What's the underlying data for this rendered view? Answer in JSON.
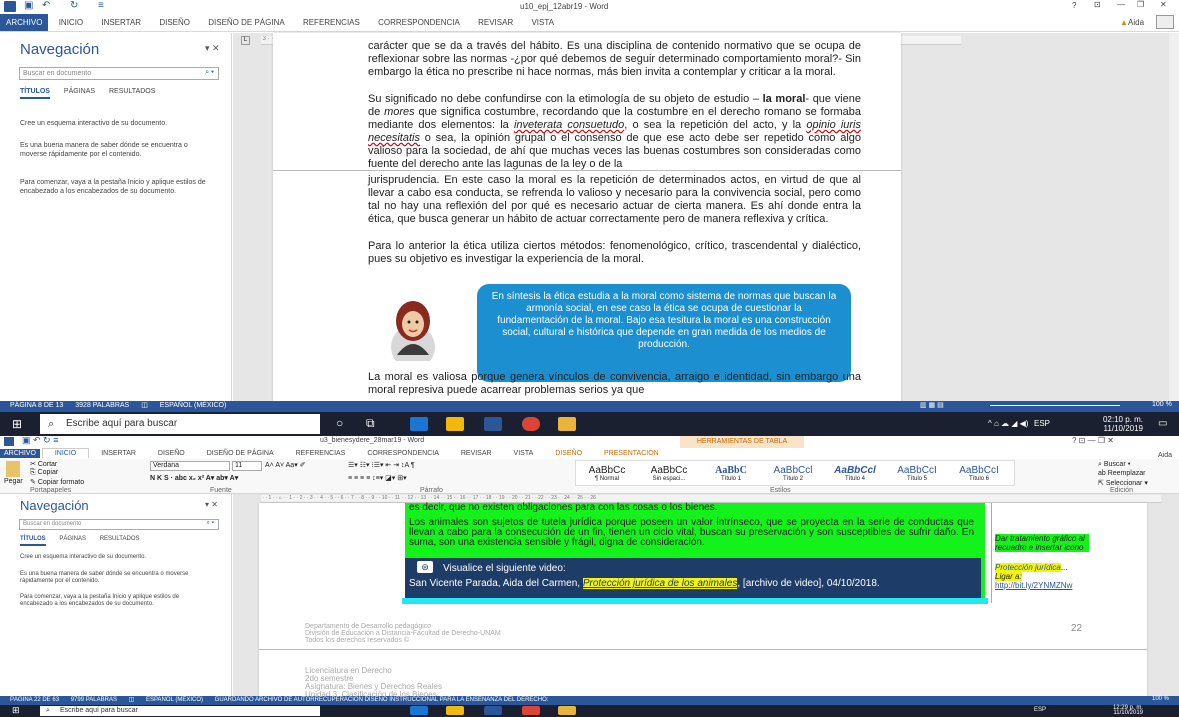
{
  "win1": {
    "title": "u10_epj_12abr19 - Word",
    "user": "Aida",
    "tabs": [
      "ARCHIVO",
      "INICIO",
      "INSERTAR",
      "DISEÑO",
      "DISEÑO DE PÁGINA",
      "REFERENCIAS",
      "CORRESPONDENCIA",
      "REVISAR",
      "VISTA"
    ],
    "nav": {
      "title": "Navegación",
      "search_placeholder": "Buscar en documento",
      "tabs": [
        "TÍTULOS",
        "PÁGINAS",
        "RESULTADOS"
      ],
      "paras": [
        "Cree un esquema interactivo de su documento.",
        "Es una buena manera de saber dónde se encuentra o moverse rápidamente por el contenido.",
        "Para comenzar, vaya a la pestaña Inicio y aplique estilos de encabezado a los encabezados de su documento."
      ]
    },
    "doc": {
      "p0": "carácter que se da a través del hábito. Es una disciplina de contenido normativo que se ocupa de reflexionar sobre las normas -¿por qué debemos de seguir determinado comportamiento moral?- Sin embargo la ética no prescribe ni hace normas, más bien invita a contemplar y criticar a la moral.",
      "p1a": "Su significado no debe confundirse con la etimología de su objeto de estudio –",
      "p1b": "la moral",
      "p1c": "- que viene de ",
      "p1d": "mores",
      "p1e": " que significa costumbre, recordando que la costumbre en el derecho romano se formaba mediante dos elementos: la ",
      "p1f": "inveterata consuetudo",
      "p1g": ", o sea la repetición del acto, y la ",
      "p1h": "opinio iuris necesitatis",
      "p1i": " o sea, la opinión grupal o el consenso de que ese acto debe ser repetido como algo valioso para la sociedad, de ahí que muchas veces las buenas costumbres son consideradas como fuente del derecho ante las lagunas de la ley o de la",
      "p2": "jurisprudencia. En este caso la moral es la repetición de determinados actos, en virtud de que al llevar a cabo esa conducta, se refrenda lo valioso y necesario para la convivencia social, pero como tal no hay una reflexión del por qué es necesario actuar de cierta manera. Es ahí donde entra la ética, que busca generar un hábito de actuar correctamente pero de manera reflexiva y crítica.",
      "p3": "Para lo anterior la ética utiliza ciertos métodos: fenomenológico, crítico, trascendental y dialéctico, pues su objetivo es investigar la experiencia de la moral.",
      "bubble": "En síntesis la ética estudia a la moral como sistema de normas que buscan la armonía social, en ese caso la ética se ocupa de cuestionar la fundamentación de la moral. Bajo esa tesitura la moral es una construcción social, cultural e histórica que depende en gran medida de los medios de producción.",
      "p4": "La moral es valiosa porque genera vínculos de convivencia, arraigo e identidad, sin embargo una moral represiva puede acarrear problemas serios ya que"
    },
    "status": [
      "PÁGINA 8 DE 13",
      "3928 PALABRAS",
      "ESPAÑOL (MÉXICO)"
    ],
    "zoom": "100 %",
    "taskbar": {
      "search": "Escribe aquí para buscar",
      "lang": "ESP",
      "time": "02:10 p. m.",
      "date": "11/10/2019"
    }
  },
  "win2": {
    "title": "u3_bienesydere_28mar19 - Word",
    "context_tab": "HERRAMIENTAS DE TABLA",
    "user": "Aida",
    "tabs": [
      "ARCHIVO",
      "INICIO",
      "INSERTAR",
      "DISEÑO",
      "DISEÑO DE PÁGINA",
      "REFERENCIAS",
      "CORRESPONDENCIA",
      "REVISAR",
      "VISTA",
      "DISEÑO",
      "PRESENTACIÓN"
    ],
    "clipboard": {
      "paste": "Pegar",
      "cut": "Cortar",
      "copy": "Copiar",
      "format": "Copiar formato",
      "group": "Portapapeles"
    },
    "font": {
      "name": "Verdana",
      "size": "11",
      "group": "Fuente"
    },
    "para_group": "Párrafo",
    "styles_group": "Estilos",
    "edit_group": "Edición",
    "styles": [
      {
        "sample": "AaBbCc",
        "name": "¶ Normal"
      },
      {
        "sample": "AaBbCc",
        "name": "Sin espaci..."
      },
      {
        "sample": "AaBbC",
        "name": "Título 1"
      },
      {
        "sample": "AaBbCcl",
        "name": "Título 2"
      },
      {
        "sample": "AaBbCcl",
        "name": "Título 4"
      },
      {
        "sample": "AaBbCcI",
        "name": "Título 5"
      },
      {
        "sample": "AaBbCcI",
        "name": "Título 6"
      }
    ],
    "edit": [
      "Buscar",
      "Reemplazar",
      "Seleccionar"
    ],
    "nav": {
      "title": "Navegación",
      "search_placeholder": "Buscar en documento",
      "tabs": [
        "TÍTULOS",
        "PÁGINAS",
        "RESULTADOS"
      ],
      "paras": [
        "Cree un esquema interactivo de su documento.",
        "Es una buena manera de saber dónde se encuentra o moverse rápidamente por el contenido.",
        "Para comenzar, vaya a la pestaña Inicio y aplique estilos de encabezado a los encabezados de su documento."
      ]
    },
    "doc": {
      "top": "es decir, que no existen obligaciones para con las cosas o los bienes.",
      "para": "Los animales son sujetos de tutela jurídica porque poseen un valor intrínseco, que se proyecta en la serie de conductas que llevan a cabo para la consecución de un fin, tienen un ciclo vital, buscan su preservación y son susceptibles de sufrir daño. En suma, son una existencia sensible y frágil, digna de consideración.",
      "video_label": "Visualice el siguiente video:",
      "cite_a": "San Vicente Parada, Aida del Carmen, ",
      "cite_b": "Protección jurídica de los animales",
      "cite_c": ", [archivo de video], 04/10/2018.",
      "note1": "Dar tratamiento gráfico al recuadro e insertar icono",
      "note2a": "Protección jurídica",
      "note2b": "...",
      "note2c": "Ligar a:",
      "note2d": "http://bit.ly/2YNMZNw",
      "footer1": "Departamento de Desarrollo pedagógico",
      "footer2": "División de Educación a Distancia-Facultad de Derecho-UNAM",
      "footer3": "Todos los derechos reservados ©",
      "page_num": "22",
      "h1": "Licenciatura en Derecho",
      "h2": "2do semestre",
      "h3": "Asignatura: Bienes y Derechos Reales",
      "h4": "Unidad 3. Clasificación de los Bienes"
    },
    "status": [
      "PÁGINA 22 DE 63",
      "9799 PALABRAS",
      "ESPAÑOL (MÉXICO)",
      "GUARDANDO ARCHIVO DE AUTORRECUPERACIÓN DISEÑO INSTRUCCIONAL PARA LA ENSEÑANZA DEL DERECHO:"
    ],
    "zoom": "100 %",
    "taskbar": {
      "search": "Escribe aquí para buscar",
      "lang": "ESP",
      "time": "12:29 p. m.",
      "date": "11/10/2019"
    }
  },
  "colors": {
    "word_blue": "#2b579a",
    "bubble": "#1c8fd0",
    "green": "#13f21a",
    "cyan": "#21e8f5",
    "navy": "#1e3c68",
    "yellow": "#f5f50a"
  }
}
